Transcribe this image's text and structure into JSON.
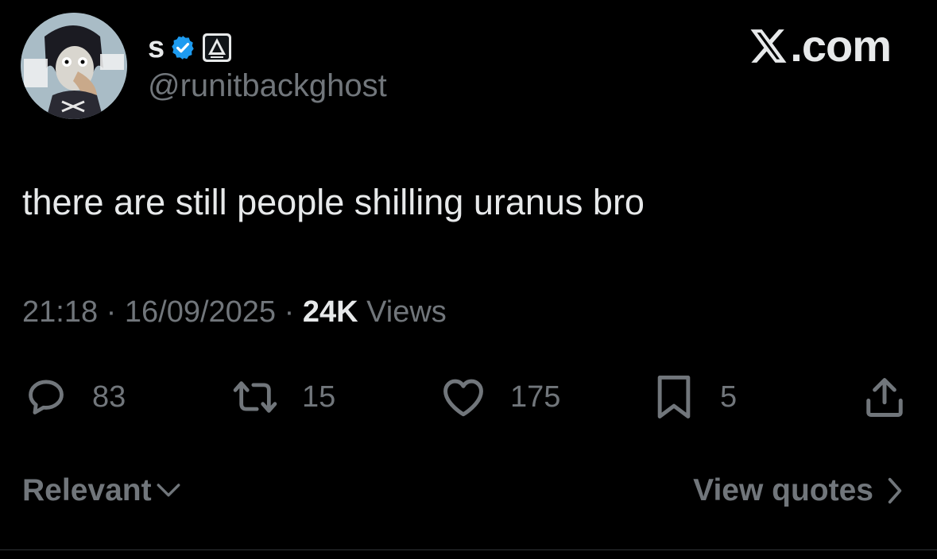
{
  "author": {
    "display_name": "s",
    "handle": "@runitbackghost"
  },
  "brand": {
    "label": ".com"
  },
  "tweet": {
    "text": "there are still people shilling uranus bro",
    "time": "21:18",
    "date": "16/09/2025",
    "views_count": "24K",
    "views_label": "Views",
    "separator": " · "
  },
  "actions": {
    "replies": "83",
    "reposts": "15",
    "likes": "175",
    "bookmarks": "5"
  },
  "footer": {
    "sort_label": "Relevant",
    "view_quotes_label": "View quotes"
  },
  "icons": {
    "avatar": "cartoon-avatar",
    "verified": "verified-badge-icon",
    "affiliate": "affiliate-badge-icon",
    "x_logo": "x-logo-icon",
    "reply": "reply-icon",
    "repost": "repost-icon",
    "like": "heart-icon",
    "bookmark": "bookmark-icon",
    "share": "share-icon"
  },
  "colors": {
    "background": "#000000",
    "primary_text": "#e7e9ea",
    "secondary_text": "#71767b",
    "verified_blue": "#1d9bf0"
  }
}
